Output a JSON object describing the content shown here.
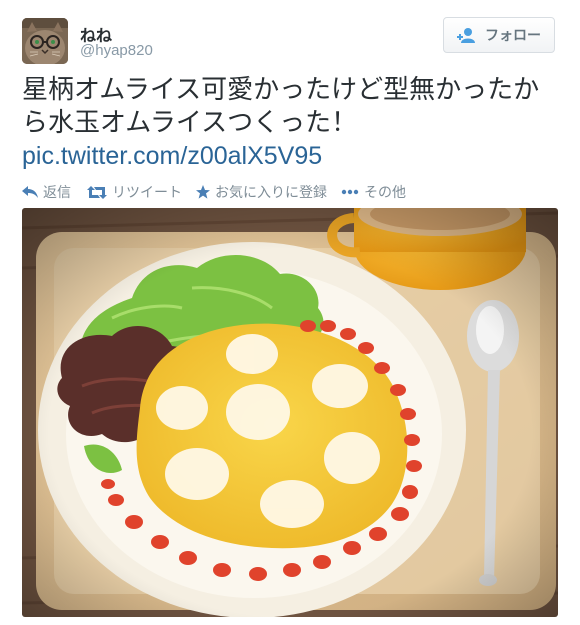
{
  "user": {
    "display_name": "ねね",
    "handle": "@hyap820"
  },
  "follow_button": {
    "label": "フォロー"
  },
  "tweet": {
    "text": "星柄オムライス可愛かったけど型無かったから水玉オムライスつくった！",
    "link": "pic.twitter.com/z00alX5V95"
  },
  "actions": {
    "reply": "返信",
    "retweet": "リツイート",
    "favorite": "お気に入りに登録",
    "more": "その他"
  },
  "colors": {
    "link": "#2a6496",
    "action_icon": "#4a7fb5",
    "action_text": "#7f8d97"
  },
  "icons": [
    "reply-icon",
    "retweet-icon",
    "star-icon",
    "more-icon",
    "add-user-icon"
  ]
}
